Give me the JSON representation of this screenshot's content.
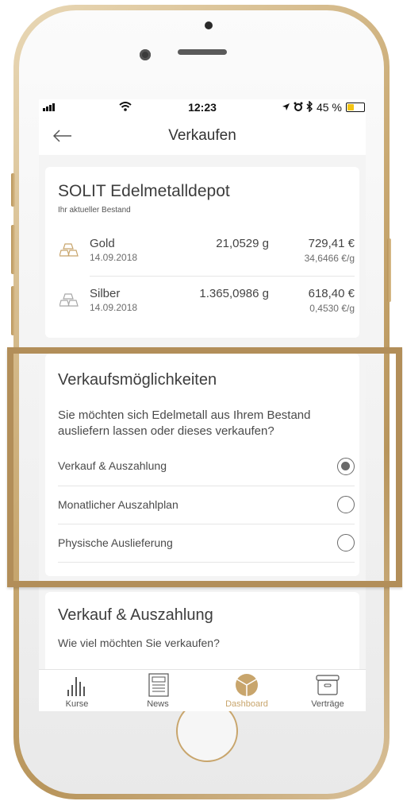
{
  "status_bar": {
    "time": "12:23",
    "battery_percent": "45 %",
    "battery_level": 0.45
  },
  "nav": {
    "title": "Verkaufen"
  },
  "depot": {
    "title": "SOLIT Edelmetalldepot",
    "subtitle": "Ihr aktueller Bestand",
    "holdings": [
      {
        "name": "Gold",
        "date": "14.09.2018",
        "amount": "21,0529 g",
        "value": "729,41 €",
        "unit_price": "34,6466 €/g",
        "icon": "gold-bars-icon"
      },
      {
        "name": "Silber",
        "date": "14.09.2018",
        "amount": "1.365,0986 g",
        "value": "618,40 €",
        "unit_price": "0,4530 €/g",
        "icon": "silver-bars-icon"
      }
    ]
  },
  "options": {
    "title": "Verkaufsmöglichkeiten",
    "description": "Sie möchten sich Edelmetall aus Ihrem Bestand ausliefern lassen oder dieses verkaufen?",
    "items": [
      {
        "label": "Verkauf & Auszahlung",
        "selected": true
      },
      {
        "label": "Monatlicher Auszahlplan",
        "selected": false
      },
      {
        "label": "Physische Auslieferung",
        "selected": false
      }
    ]
  },
  "sale": {
    "title": "Verkauf & Auszahlung",
    "question": "Wie viel möchten Sie verkaufen?"
  },
  "tabs": [
    {
      "label": "Kurse",
      "icon": "bar-chart-icon",
      "active": false
    },
    {
      "label": "News",
      "icon": "newspaper-icon",
      "active": false
    },
    {
      "label": "Dashboard",
      "icon": "dashboard-pie-icon",
      "active": true
    },
    {
      "label": "Verträge",
      "icon": "archive-box-icon",
      "active": false
    }
  ],
  "colors": {
    "accent": "#c8a56c",
    "highlight": "#b28e59",
    "battery": "#f3c414"
  }
}
